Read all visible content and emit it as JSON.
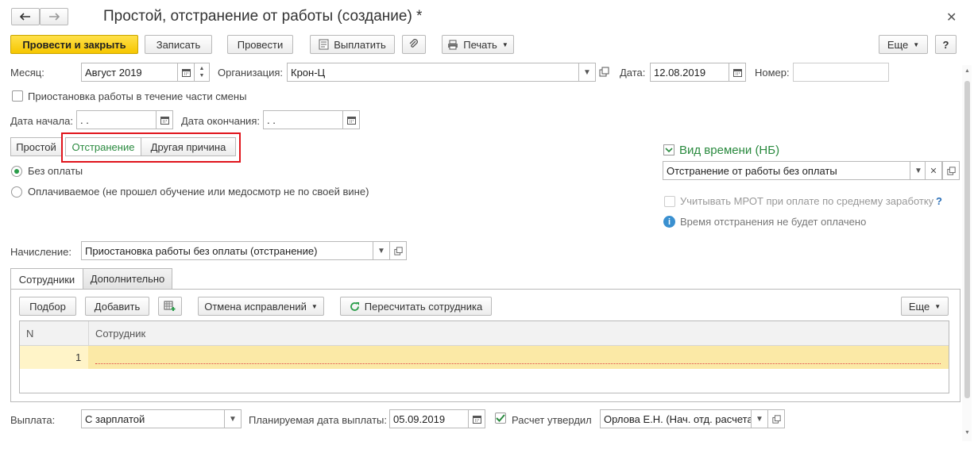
{
  "window": {
    "title": "Простой, отстранение от работы (создание) *",
    "close_icon": "close-icon"
  },
  "toolbar": {
    "post_close": "Провести и закрыть",
    "save": "Записать",
    "post": "Провести",
    "pay": "Выплатить",
    "print": "Печать",
    "more": "Еще",
    "help": "?"
  },
  "form": {
    "month_label": "Месяц:",
    "month_value": "Август 2019",
    "org_label": "Организация:",
    "org_value": "Крон-Ц",
    "date_label": "Дата:",
    "date_value": "12.08.2019",
    "number_label": "Номер:",
    "number_value": "",
    "partial_shift_label": "Приостановка работы в течение части смены",
    "start_label": "Дата начала:",
    "start_value": " .  .",
    "end_label": "Дата окончания:",
    "end_value": " .  ."
  },
  "segments": [
    "Простой",
    "Отстранение",
    "Другая причина"
  ],
  "payment_options": {
    "unpaid": "Без оплаты",
    "paid": "Оплачиваемое (не прошел обучение или медосмотр не по своей вине)"
  },
  "time_type": {
    "title": "Вид времени (НБ)",
    "value": "Отстранение от работы без оплаты",
    "mrot_label": "Учитывать МРОТ при оплате по среднему заработку",
    "mrot_help": "?",
    "info": "Время отстранения не будет оплачено"
  },
  "accrual": {
    "label": "Начисление:",
    "value": "Приостановка работы без оплаты (отстранение)"
  },
  "tabs": [
    "Сотрудники",
    "Дополнительно"
  ],
  "table_toolbar": {
    "select": "Подбор",
    "add": "Добавить",
    "cancel_fix": "Отмена исправлений",
    "recalc": "Пересчитать сотрудника",
    "more": "Еще"
  },
  "table": {
    "columns": [
      "N",
      "Сотрудник"
    ],
    "rows": [
      {
        "n": "1",
        "employee": ""
      }
    ]
  },
  "footer": {
    "payout_label": "Выплата:",
    "payout_value": "С зарплатой",
    "plan_date_label": "Планируемая дата выплаты:",
    "plan_date_value": "05.09.2019",
    "approved_label": "Расчет утвердил",
    "approver_value": "Орлова Е.Н. (Нач. отд. расчета"
  },
  "colors": {
    "accent_green": "#2a8a3f",
    "primary_yellow": "#f6c600",
    "highlight_red": "#e0141b",
    "row_highlight": "#fbe9a6"
  }
}
